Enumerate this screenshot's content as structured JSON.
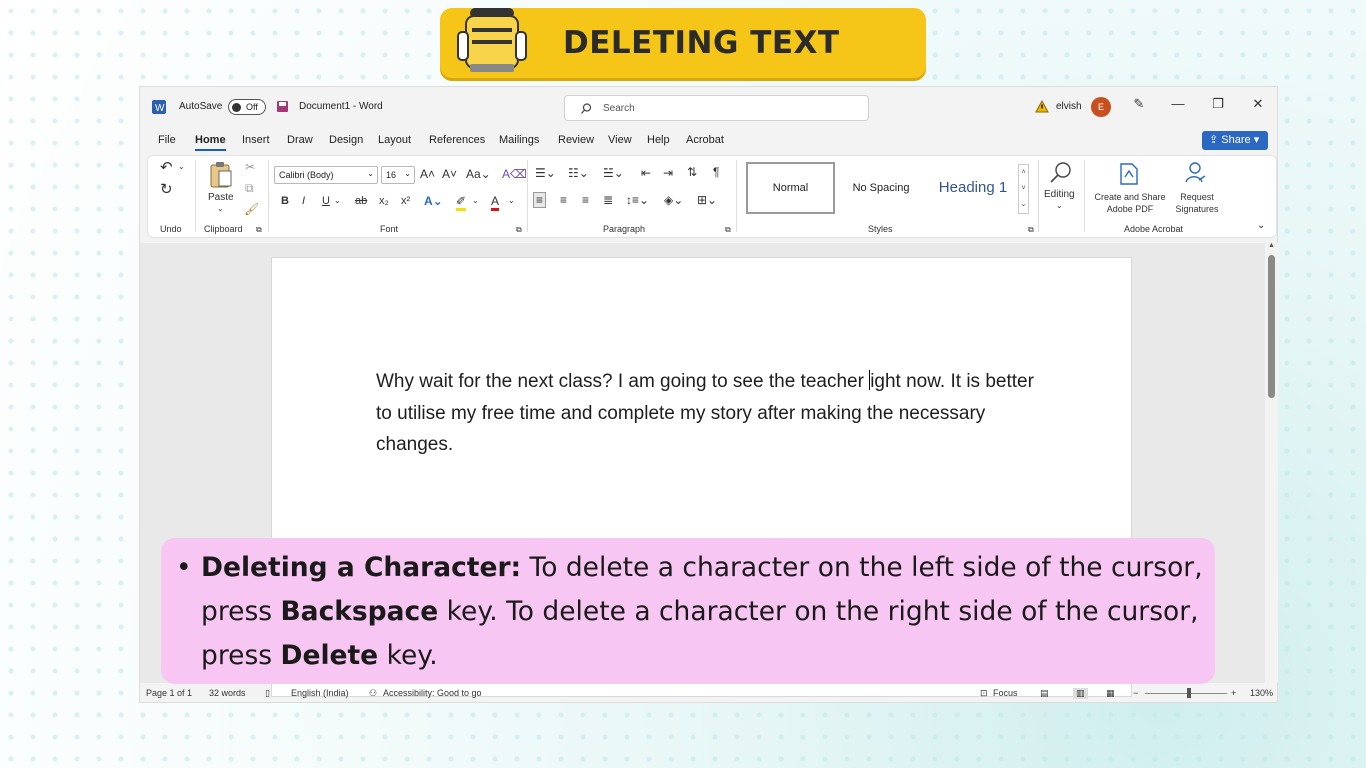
{
  "banner": {
    "title": "DELETING TEXT"
  },
  "titlebar": {
    "autosave": "AutoSave",
    "toggle": "Off",
    "doc_title": "Document1 - Word",
    "search_placeholder": "Search",
    "user": "elvish",
    "avatar_letter": "E"
  },
  "menu": [
    "File",
    "Home",
    "Insert",
    "Draw",
    "Design",
    "Layout",
    "References",
    "Mailings",
    "Review",
    "View",
    "Help",
    "Acrobat"
  ],
  "share": "Share",
  "ribbon": {
    "undo_label": "Undo",
    "paste_label": "Paste",
    "clipboard_label": "Clipboard",
    "font_name": "Calibri (Body)",
    "font_size": "16",
    "font_label": "Font",
    "paragraph_label": "Paragraph",
    "styles": [
      "Normal",
      "No Spacing",
      "Heading 1"
    ],
    "styles_label": "Styles",
    "editing_label": "Editing",
    "create_pdf": "Create and Share Adobe PDF",
    "request_sig": "Request Signatures",
    "adobe_label": "Adobe Acrobat"
  },
  "document": {
    "text_before_cursor": "Why wait for the next class? I am going to see the teacher ",
    "text_after_cursor": "ight now. It is better to utilise my free time and complete my story after making the necessary changes."
  },
  "status": {
    "page": "Page 1 of 1",
    "words": "32 words",
    "language": "English (India)",
    "accessibility": "Accessibility: Good to go",
    "focus": "Focus",
    "zoom": "130%"
  },
  "note": {
    "heading": "Deleting a Character:",
    "t1": " To delete a character on the left side of the cursor, press ",
    "k1": "Backspace",
    "t2": " key. To delete a character on the right side of the cursor, press ",
    "k2": "Delete",
    "t3": " key."
  }
}
